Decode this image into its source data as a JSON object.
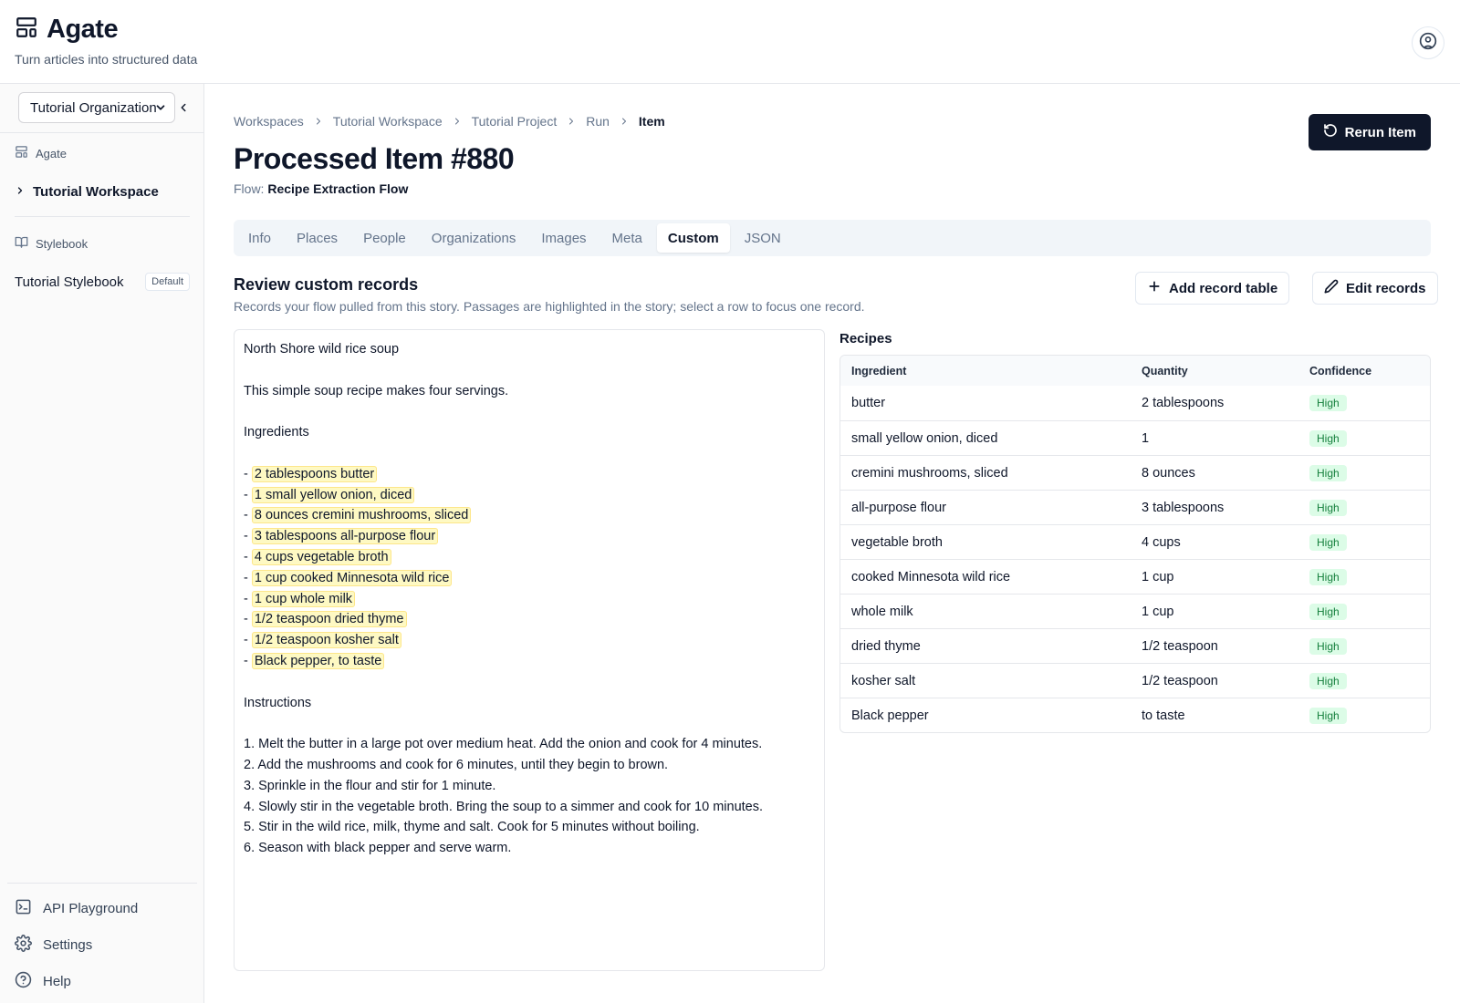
{
  "app": {
    "title": "Agate",
    "tagline": "Turn articles into structured data"
  },
  "sidebar": {
    "org_select": "Tutorial Organization",
    "agate_section": "Agate",
    "workspace": "Tutorial Workspace",
    "stylebook_section": "Stylebook",
    "stylebook_item": "Tutorial Stylebook",
    "stylebook_badge": "Default",
    "bottom": {
      "api_playground": "API Playground",
      "settings": "Settings",
      "help": "Help"
    }
  },
  "breadcrumb": [
    "Workspaces",
    "Tutorial Workspace",
    "Tutorial Project",
    "Run",
    "Item"
  ],
  "page": {
    "title": "Processed Item #880",
    "flow_label": "Flow:",
    "flow_name": "Recipe Extraction Flow",
    "rerun_label": "Rerun Item"
  },
  "tabs": [
    "Info",
    "Places",
    "People",
    "Organizations",
    "Images",
    "Meta",
    "Custom",
    "JSON"
  ],
  "active_tab": "Custom",
  "section": {
    "title": "Review custom records",
    "description": "Records your flow pulled from this story. Passages are highlighted in the story; select a row to focus one record.",
    "add_table_label": "Add record table",
    "edit_records_label": "Edit records"
  },
  "story": {
    "lines": [
      {
        "prefix": "",
        "text": "North Shore wild rice soup"
      },
      {
        "prefix": "",
        "text": ""
      },
      {
        "prefix": "",
        "text": "This simple soup recipe makes four servings."
      },
      {
        "prefix": "",
        "text": ""
      },
      {
        "prefix": "",
        "text": "Ingredients"
      },
      {
        "prefix": "",
        "text": ""
      },
      {
        "prefix": "- ",
        "highlight": "2 tablespoons butter"
      },
      {
        "prefix": "- ",
        "highlight": "1 small yellow onion, diced"
      },
      {
        "prefix": "- ",
        "highlight": "8 ounces cremini mushrooms, sliced"
      },
      {
        "prefix": "- ",
        "highlight": "3 tablespoons all-purpose flour"
      },
      {
        "prefix": "- ",
        "highlight": "4 cups vegetable broth"
      },
      {
        "prefix": "- ",
        "highlight": "1 cup cooked Minnesota wild rice"
      },
      {
        "prefix": "- ",
        "highlight": "1 cup whole milk"
      },
      {
        "prefix": "- ",
        "highlight": "1/2 teaspoon dried thyme"
      },
      {
        "prefix": "- ",
        "highlight": "1/2 teaspoon kosher salt"
      },
      {
        "prefix": "- ",
        "highlight": "Black pepper, to taste"
      },
      {
        "prefix": "",
        "text": ""
      },
      {
        "prefix": "",
        "text": "Instructions"
      },
      {
        "prefix": "",
        "text": ""
      },
      {
        "prefix": "",
        "text": "1. Melt the butter in a large pot over medium heat. Add the onion and cook for 4 minutes."
      },
      {
        "prefix": "",
        "text": "2. Add the mushrooms and cook for 6 minutes, until they begin to brown."
      },
      {
        "prefix": "",
        "text": "3. Sprinkle in the flour and stir for 1 minute."
      },
      {
        "prefix": "",
        "text": "4. Slowly stir in the vegetable broth. Bring the soup to a simmer and cook for 10 minutes."
      },
      {
        "prefix": "",
        "text": "5. Stir in the wild rice, milk, thyme and salt. Cook for 5 minutes without boiling."
      },
      {
        "prefix": "",
        "text": "6. Season with black pepper and serve warm."
      }
    ]
  },
  "recipes": {
    "label": "Recipes",
    "columns": [
      "Ingredient",
      "Quantity",
      "Confidence"
    ],
    "rows": [
      {
        "ingredient": "butter",
        "quantity": "2 tablespoons",
        "confidence": "High"
      },
      {
        "ingredient": "small yellow onion, diced",
        "quantity": "1",
        "confidence": "High"
      },
      {
        "ingredient": "cremini mushrooms, sliced",
        "quantity": "8 ounces",
        "confidence": "High"
      },
      {
        "ingredient": "all-purpose flour",
        "quantity": "3 tablespoons",
        "confidence": "High"
      },
      {
        "ingredient": "vegetable broth",
        "quantity": "4 cups",
        "confidence": "High"
      },
      {
        "ingredient": "cooked Minnesota wild rice",
        "quantity": "1 cup",
        "confidence": "High"
      },
      {
        "ingredient": "whole milk",
        "quantity": "1 cup",
        "confidence": "High"
      },
      {
        "ingredient": "dried thyme",
        "quantity": "1/2 teaspoon",
        "confidence": "High"
      },
      {
        "ingredient": "kosher salt",
        "quantity": "1/2 teaspoon",
        "confidence": "High"
      },
      {
        "ingredient": "Black pepper",
        "quantity": "to taste",
        "confidence": "High"
      }
    ]
  },
  "colors": {
    "primary": "#0f172a",
    "highlight_bg": "#fef9c3",
    "confidence_bg": "#dcfce7",
    "confidence_text": "#15803d"
  }
}
